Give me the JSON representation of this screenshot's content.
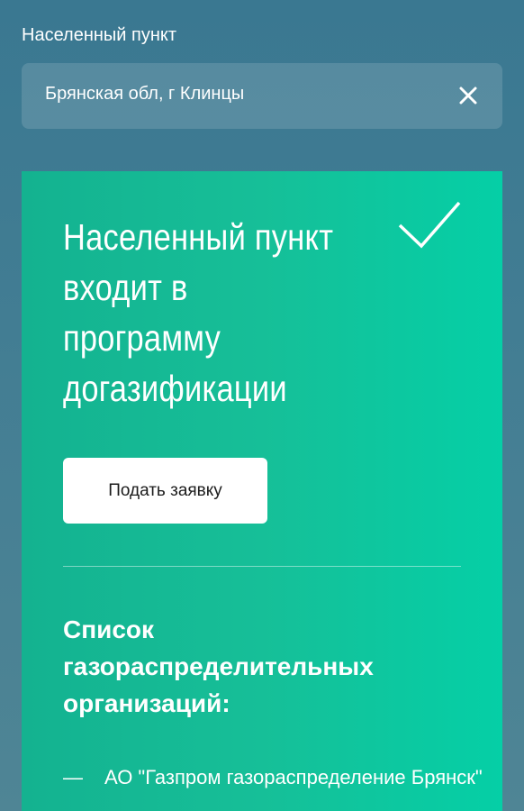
{
  "locality": {
    "label": "Населенный пункт",
    "value": "Брянская обл, г Клинцы",
    "clear_icon": "close-icon"
  },
  "result": {
    "title": "Населенный пункт входит в программу догазификации",
    "status_icon": "checkmark-icon",
    "apply_button": "Подать заявку",
    "orgs_heading": "Список газораспределительных организаций:",
    "orgs": [
      {
        "dash": "—",
        "name": "АО \"Газпром газораспределение Брянск\""
      }
    ]
  },
  "colors": {
    "background": "#3a7891",
    "card": "#16bf98",
    "text": "#ffffff"
  }
}
